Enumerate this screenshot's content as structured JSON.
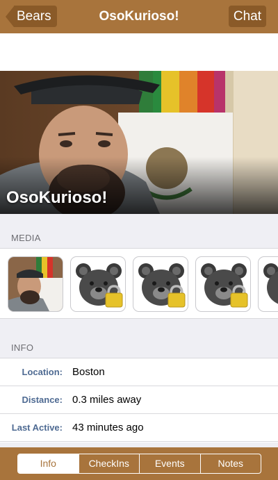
{
  "nav": {
    "back_label": "Bears",
    "title": "OsoKurioso!",
    "chat_label": "Chat"
  },
  "profile": {
    "name": "OsoKurioso!"
  },
  "media": {
    "header": "MEDIA",
    "items": [
      {
        "kind": "photo"
      },
      {
        "kind": "locked-bear-icon"
      },
      {
        "kind": "locked-bear-icon"
      },
      {
        "kind": "locked-bear-icon"
      },
      {
        "kind": "locked-bear-icon"
      }
    ]
  },
  "info": {
    "header": "INFO",
    "rows": [
      {
        "label": "Location:",
        "value": "Boston"
      },
      {
        "label": "Distance:",
        "value": "0.3 miles away"
      },
      {
        "label": "Last Active:",
        "value": "43 minutes ago"
      }
    ]
  },
  "tabs": {
    "items": [
      "Info",
      "CheckIns",
      "Events",
      "Notes"
    ],
    "active": "Info"
  },
  "colors": {
    "bar_brown": "#a8743c",
    "button_brown": "#8a5a28",
    "label_blue": "#4e6a92"
  }
}
